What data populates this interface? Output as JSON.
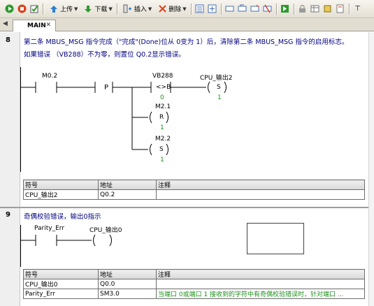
{
  "toolbar": {
    "upload_label": "上传",
    "download_label": "下载",
    "insert_label": "插入",
    "delete_label": "删除"
  },
  "tabs": [
    {
      "label": "MAIN"
    }
  ],
  "networks": [
    {
      "number": "8",
      "comment_lines": [
        "第二条 MBUS_MSG 指令完成（\"完成\"(Done)位从 0变为 1）后，清除第二条 MBUS_MSG 指令的启用标志。",
        "如果错误 （VB288）不为零，则置位 Q0.2显示错误。"
      ],
      "ladder": {
        "contact1_label": "M0.2",
        "p_label": "P",
        "cmp_label": "VB288",
        "cmp_op": "<>B",
        "cmp_val": "0",
        "coil1_label": "CPU_输出2",
        "coil1_type": "S",
        "coil1_val": "1",
        "coil2_label": "M2.1",
        "coil2_type": "R",
        "coil2_val": "1",
        "coil3_label": "M2.2",
        "coil3_type": "S",
        "coil3_val": "1"
      },
      "symbol_table": {
        "headers": [
          "符号",
          "地址",
          "注释"
        ],
        "rows": [
          [
            "CPU_输出2",
            "Q0.2",
            ""
          ]
        ]
      }
    },
    {
      "number": "9",
      "comment_lines": [
        "奇偶校验错误，输出0指示"
      ],
      "ladder": {
        "contact1_label": "Parity_Err",
        "coil1_label": "CPU_输出0"
      },
      "symbol_table": {
        "headers": [
          "符号",
          "地址",
          "注释"
        ],
        "rows": [
          [
            "CPU_输出0",
            "Q0.0",
            ""
          ],
          [
            "Parity_Err",
            "SM3.0",
            "当端口 0或端口 1 接收到的字符中有奇偶校验错误时，针对端口 ..."
          ]
        ]
      }
    }
  ]
}
